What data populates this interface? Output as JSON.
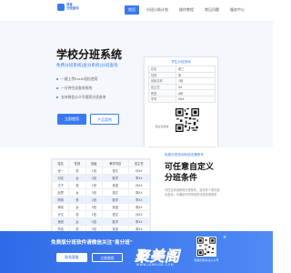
{
  "header": {
    "logo_line1": "易查",
    "logo_line2": "分班查询",
    "nav": [
      "首页",
      "分班小助计划",
      "操作教程",
      "常见问题",
      "服务中心"
    ]
  },
  "hero": {
    "title": "学校分班系统",
    "subtitle": "免费分班系统|查分系统|分班查询",
    "bullets": [
      "一键上传Excel轻松使用",
      "一分钟生成查询系统",
      "支持微信公众号搜索分班查询"
    ],
    "btn_primary": "立即使用",
    "btn_secondary": "产品案例"
  },
  "card": {
    "title": "学生分班查询",
    "rows": [
      {
        "k": "姓名",
        "v": "张三"
      },
      {
        "k": "性别",
        "v": "男"
      },
      {
        "k": "班级名称",
        "v": "1班"
      },
      {
        "k": "班主任",
        "v": "XX"
      },
      {
        "k": "教室",
        "v": "A栋"
      },
      {
        "k": "学号",
        "v": "XXX"
      }
    ],
    "qr_label": "班主任微信",
    "footer": "班级"
  },
  "table": {
    "headers": [
      "姓名",
      "性别",
      "班级",
      "教学内容",
      "班主任"
    ],
    "rows": [
      [
        "张一",
        "男",
        "1班",
        "语文",
        "孙XX"
      ],
      [
        "刘佳",
        "女",
        "2班",
        "数学",
        "李XX"
      ],
      [
        "王子",
        "男",
        "1班",
        "英语",
        "孙XX"
      ],
      [
        "赵思",
        "女",
        "3班",
        "语文",
        "周XX"
      ],
      [
        "陈明",
        "男",
        "2班",
        "数学",
        "李XX"
      ],
      [
        "林晓",
        "女",
        "3班",
        "英语",
        "周XX"
      ],
      [
        "许文",
        "男",
        "1班",
        "语文",
        "孙XX"
      ],
      [
        "吴悦",
        "女",
        "2班",
        "数学",
        "李XX"
      ],
      [
        "郑浩",
        "男",
        "3班",
        "英语",
        "周XX"
      ]
    ]
  },
  "feature": {
    "tag": "免费分班查询系统设置条件",
    "title": "可任意自定义分班条件",
    "desc": "可任意添加修改分班条件，支持多个条件组合查询，可满足不同学校的分班查询需求"
  },
  "banner": {
    "text": "免费版分班软件请微信关注\"易分班\"",
    "btn1": "联系客服",
    "btn2": "立即使用",
    "qr_caption": "微信扫码关注公众号",
    "close": "×"
  },
  "watermark": {
    "big": "聚美阁",
    "small": "WWW.JUMEIGE.COM"
  },
  "colors": {
    "accent": "#3a7af0",
    "banner": "#2f6be6"
  }
}
